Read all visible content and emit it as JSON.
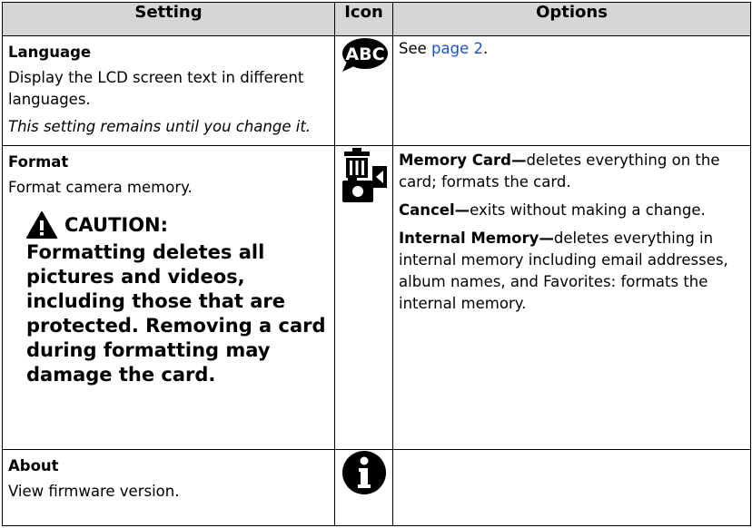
{
  "headers": {
    "setting": "Setting",
    "icon": "Icon",
    "options": "Options"
  },
  "rows": [
    {
      "title": "Language",
      "description": "Display the LCD screen text in different languages.",
      "note": "This setting remains until you change it.",
      "icon": "abc-speech-bubble-icon",
      "options_prefix": "See ",
      "options_link": "page 2",
      "options_suffix": "."
    },
    {
      "title": "Format",
      "description": "Format camera memory.",
      "caution_label": "CAUTION:",
      "caution_text": "Formatting deletes all pictures and videos, including those that are protected. Removing a card during formatting may damage the card.",
      "icon": "format-trash-camera-icon",
      "options": [
        {
          "label": "Memory Card—",
          "text": "deletes everything on the card; formats the card."
        },
        {
          "label": "Cancel—",
          "text": "exits without making a change."
        },
        {
          "label": "Internal Memory—",
          "text": "deletes everything in internal memory including email addresses, album names, and Favorites: formats the internal memory."
        }
      ]
    },
    {
      "title": "About",
      "description": "View firmware version.",
      "icon": "info-icon"
    }
  ]
}
